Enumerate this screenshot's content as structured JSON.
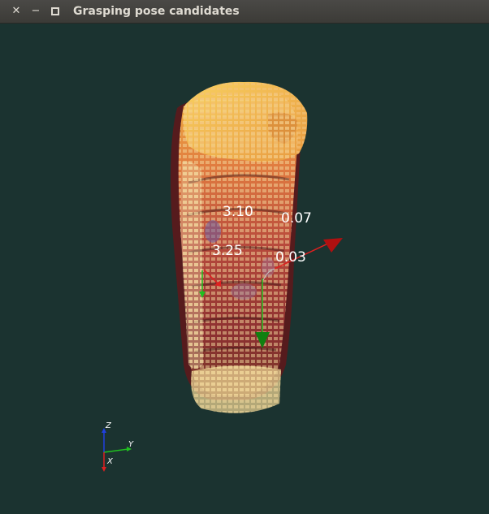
{
  "window": {
    "title": "Grasping pose candidates",
    "close_icon": "close-icon",
    "minimize_icon": "minimize-icon",
    "maximize_icon": "maximize-icon"
  },
  "viewport": {
    "background": "#1b3330",
    "labels": [
      "3.10",
      "0.07",
      "3.25",
      "0.03"
    ],
    "axes": {
      "z": "Z",
      "y": "Y",
      "x": "X"
    },
    "colors": {
      "x_axis": "#e02020",
      "y_axis": "#20c020",
      "z_axis": "#2040e0",
      "label": "#ffffff"
    }
  }
}
